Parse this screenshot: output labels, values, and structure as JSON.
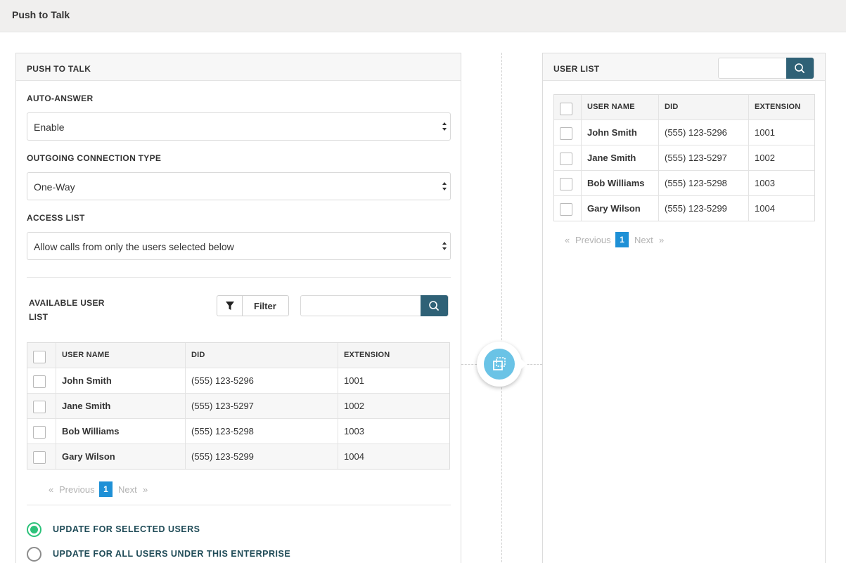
{
  "page": {
    "title": "Push to Talk"
  },
  "left_panel": {
    "title": "PUSH TO TALK",
    "auto_answer": {
      "label": "AUTO-ANSWER",
      "value": "Enable"
    },
    "outgoing": {
      "label": "OUTGOING CONNECTION TYPE",
      "value": "One-Way"
    },
    "access": {
      "label": "ACCESS LIST",
      "value": "Allow calls from only the users selected below"
    },
    "available": {
      "label": "AVAILABLE USER LIST",
      "filter_label": "Filter",
      "search_placeholder": "",
      "columns": [
        "USER NAME",
        "DID",
        "EXTENSION"
      ],
      "rows": [
        {
          "name": "John Smith",
          "did": "(555) 123-5296",
          "ext": "1001"
        },
        {
          "name": "Jane Smith",
          "did": "(555) 123-5297",
          "ext": "1002"
        },
        {
          "name": "Bob Williams",
          "did": "(555) 123-5298",
          "ext": "1003"
        },
        {
          "name": "Gary Wilson",
          "did": "(555) 123-5299",
          "ext": "1004"
        }
      ],
      "pager": {
        "prev": "Previous",
        "page": "1",
        "next": "Next"
      }
    },
    "update_options": [
      {
        "label": "UPDATE FOR SELECTED USERS",
        "checked": true
      },
      {
        "label": "UPDATE FOR ALL USERS UNDER THIS ENTERPRISE",
        "checked": false
      }
    ]
  },
  "right_panel": {
    "title": "USER LIST",
    "search_placeholder": "",
    "columns": [
      "USER NAME",
      "DID",
      "EXTENSION"
    ],
    "rows": [
      {
        "name": "John Smith",
        "did": "(555) 123-5296",
        "ext": "1001"
      },
      {
        "name": "Jane Smith",
        "did": "(555) 123-5297",
        "ext": "1002"
      },
      {
        "name": "Bob Williams",
        "did": "(555) 123-5298",
        "ext": "1003"
      },
      {
        "name": "Gary Wilson",
        "did": "(555) 123-5299",
        "ext": "1004"
      }
    ],
    "pager": {
      "prev": "Previous",
      "page": "1",
      "next": "Next"
    }
  },
  "colors": {
    "accent": "#2f6176",
    "selected": "#2cc27a",
    "page_active": "#1e90d6",
    "transfer": "#6ac3e6"
  },
  "icons": {
    "search": "search-icon",
    "filter": "filter-icon",
    "transfer": "transfer-icon",
    "select_arrows": "select-arrows-icon"
  }
}
